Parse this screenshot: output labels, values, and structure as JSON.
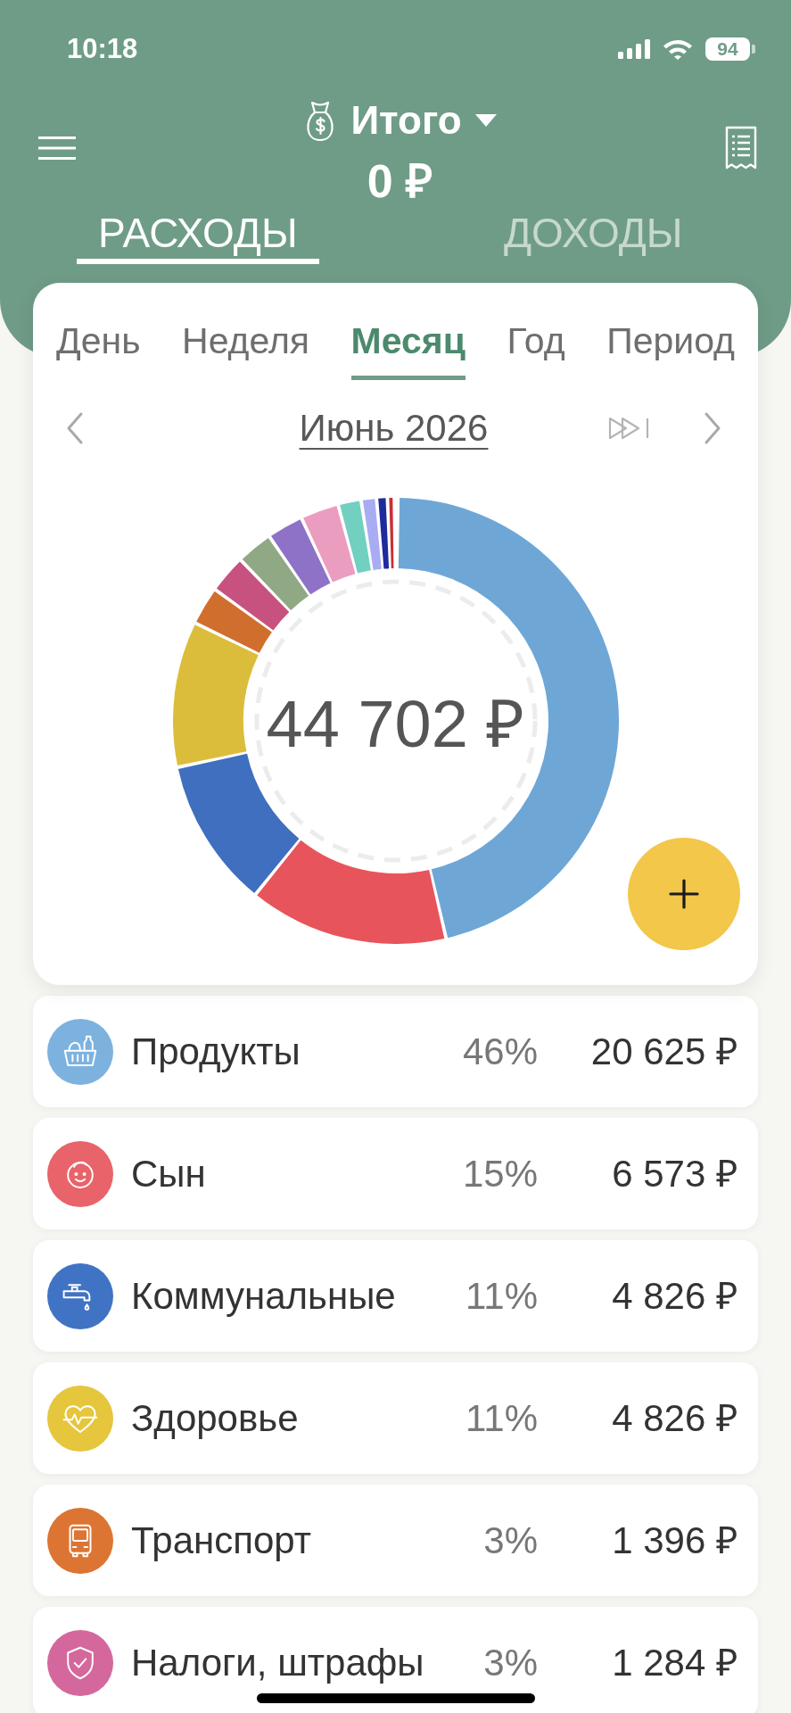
{
  "status_bar": {
    "time": "10:18",
    "battery": "94"
  },
  "header": {
    "title": "Итого",
    "total": "0 ₽",
    "tabs": [
      {
        "label": "РАСХОДЫ",
        "selected": true
      },
      {
        "label": "ДОХОДЫ",
        "selected": false
      }
    ]
  },
  "period_tabs": [
    {
      "label": "День",
      "selected": false
    },
    {
      "label": "Неделя",
      "selected": false
    },
    {
      "label": "Месяц",
      "selected": true
    },
    {
      "label": "Год",
      "selected": false
    },
    {
      "label": "Период",
      "selected": false
    }
  ],
  "month_nav": {
    "label": "Июнь 2026"
  },
  "chart": {
    "total": "44 702 ₽"
  },
  "categories": [
    {
      "name": "Продукты",
      "percent": "46%",
      "amount": "20 625 ₽",
      "color": "#7db2df"
    },
    {
      "name": "Сын",
      "percent": "15%",
      "amount": "6 573 ₽",
      "color": "#e8646a"
    },
    {
      "name": "Коммунальные",
      "percent": "11%",
      "amount": "4 826 ₽",
      "color": "#4173c5"
    },
    {
      "name": "Здоровье",
      "percent": "11%",
      "amount": "4 826 ₽",
      "color": "#e5c63d"
    },
    {
      "name": "Транспорт",
      "percent": "3%",
      "amount": "1 396 ₽",
      "color": "#dc7533"
    },
    {
      "name": "Налоги, штрафы",
      "percent": "3%",
      "amount": "1 284 ₽",
      "color": "#d4689c"
    }
  ]
}
